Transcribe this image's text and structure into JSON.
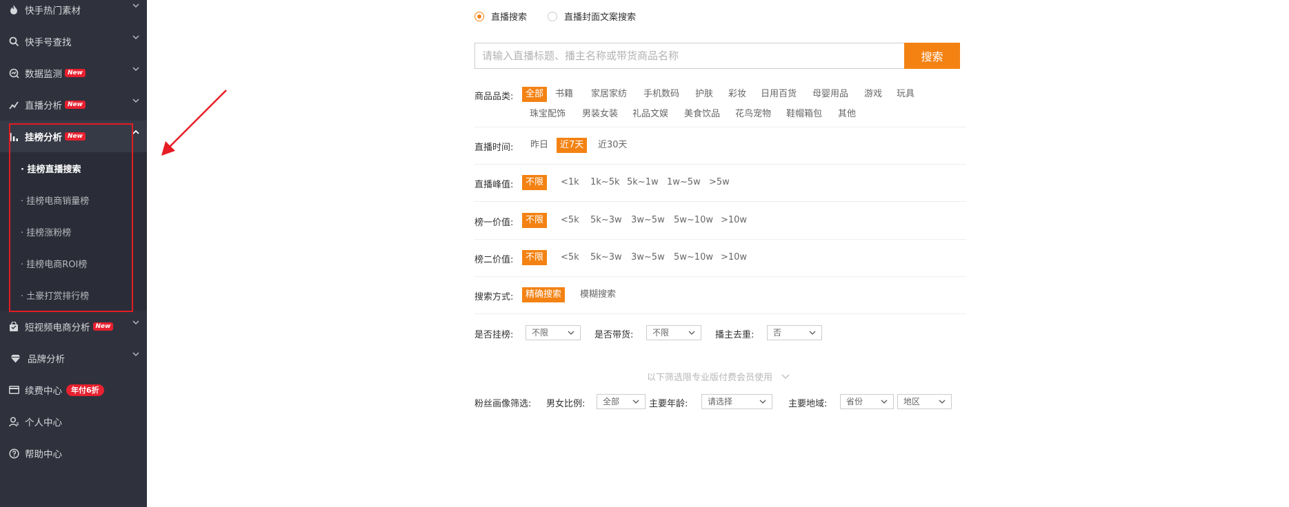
{
  "sidebar": {
    "items": [
      {
        "label": "快手热门素材",
        "icon": "fire-icon"
      },
      {
        "label": "快手号查找",
        "icon": "search-icon"
      },
      {
        "label": "数据监测",
        "icon": "monitor-icon",
        "badge": "New"
      },
      {
        "label": "直播分析",
        "icon": "trend-icon",
        "badge": "New"
      },
      {
        "label": "挂榜分析",
        "icon": "bar-chart-icon",
        "badge": "New"
      },
      {
        "label": "短视频电商分析",
        "icon": "shopping-bag-icon",
        "badge": "New"
      },
      {
        "label": "品牌分析",
        "icon": "diamond-icon"
      },
      {
        "label": "续费中心",
        "icon": "card-icon",
        "vip_badge": "年付6折"
      },
      {
        "label": "个人中心",
        "icon": "user-icon"
      },
      {
        "label": "帮助中心",
        "icon": "help-icon"
      }
    ],
    "submenu": [
      "· 挂榜直播搜索",
      "· 挂榜电商销量榜",
      "· 挂榜涨粉榜",
      "· 挂榜电商ROI榜",
      "· 土豪打赏排行榜"
    ]
  },
  "search_type": {
    "options": [
      "直播搜索",
      "直播封面文案搜索"
    ],
    "selected": "直播搜索"
  },
  "search": {
    "placeholder": "请输入直播标题、播主名称或带货商品名称",
    "button": "搜索"
  },
  "filters": {
    "category": {
      "label": "商品品类:",
      "options": [
        "全部",
        "书籍",
        "家居家纺",
        "手机数码",
        "护肤",
        "彩妆",
        "日用百货",
        "母婴用品",
        "游戏",
        "玩具",
        "珠宝配饰",
        "男装女装",
        "礼品文娱",
        "美食饮品",
        "花鸟宠物",
        "鞋帽箱包",
        "其他"
      ],
      "selected": "全部"
    },
    "time": {
      "label": "直播时间:",
      "options": [
        "昨日",
        "近7天",
        "近30天"
      ],
      "selected": "近7天"
    },
    "peak": {
      "label": "直播峰值:",
      "options": [
        "不限",
        "<1k",
        "1k~5k",
        "5k~1w",
        "1w~5w",
        ">5w"
      ],
      "selected": "不限"
    },
    "rank1": {
      "label": "榜一价值:",
      "options": [
        "不限",
        "<5k",
        "5k~3w",
        "3w~5w",
        "5w~10w",
        ">10w"
      ],
      "selected": "不限"
    },
    "rank2": {
      "label": "榜二价值:",
      "options": [
        "不限",
        "<5k",
        "5k~3w",
        "3w~5w",
        "5w~10w",
        ">10w"
      ],
      "selected": "不限"
    },
    "mode": {
      "label": "搜索方式:",
      "options": [
        "精确搜索",
        "模糊搜索"
      ],
      "selected": "精确搜索"
    },
    "dropdowns": [
      {
        "label": "是否挂榜:",
        "value": "不限"
      },
      {
        "label": "是否带货:",
        "value": "不限"
      },
      {
        "label": "播主去重:",
        "value": "否"
      }
    ]
  },
  "pro": {
    "note": "以下筛选限专业版付费会员使用",
    "fans_label": "粉丝画像筛选:",
    "gender_label": "男女比例:",
    "gender_value": "全部",
    "age_label": "主要年龄:",
    "age_value": "请选择",
    "region_label": "主要地域:",
    "province_value": "省份",
    "area_value": "地区"
  },
  "colors": {
    "accent": "#f38213",
    "sidebar_bg": "#2f323d",
    "badge": "#e8202f",
    "annotation": "#e51c23"
  }
}
